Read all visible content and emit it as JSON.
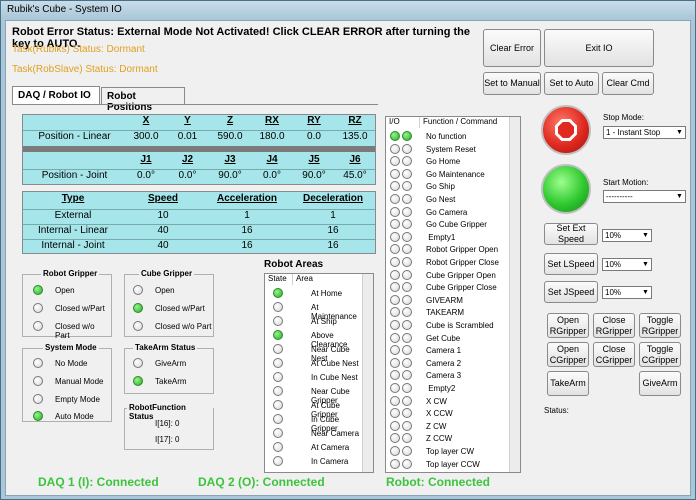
{
  "window": {
    "title": "Rubik's Cube - System IO"
  },
  "error_status": "Robot Error Status:  External Mode Not Activated!  Click CLEAR ERROR after turning the key to AUTO.",
  "task_rubiks": "Task(Rubiks) Status:  Dormant",
  "task_robslave": "Task(RobSlave) Status:  Dormant",
  "buttons": {
    "clear_error": "Clear Error",
    "exit_io": "Exit IO",
    "set_to_manual": "Set to Manual",
    "set_to_auto": "Set to Auto",
    "clear_cmd": "Clear Cmd",
    "set_ext_speed": "Set Ext Speed",
    "set_lspeed": "Set LSpeed",
    "set_jspeed": "Set JSpeed",
    "open_rgripper": "Open RGripper",
    "close_rgripper": "Close RGripper",
    "toggle_rgripper": "Toggle RGripper",
    "open_cgripper": "Open CGripper",
    "close_cgripper": "Close CGripper",
    "toggle_cgripper": "Toggle CGripper",
    "takearm": "TakeArm",
    "givearm": "GiveArm"
  },
  "tabs": [
    "DAQ / Robot IO",
    "Robot Positions"
  ],
  "position_table": {
    "linear_headers": [
      "X",
      "Y",
      "Z",
      "RX",
      "RY",
      "RZ"
    ],
    "linear_label": "Position - Linear",
    "linear_values": [
      "300.0",
      "0.01",
      "590.0",
      "180.0",
      "0.0",
      "135.0"
    ],
    "joint_headers": [
      "J1",
      "J2",
      "J3",
      "J4",
      "J5",
      "J6"
    ],
    "joint_label": "Position - Joint",
    "joint_values": [
      "0.0°",
      "0.0°",
      "90.0°",
      "0.0°",
      "90.0°",
      "45.0°"
    ]
  },
  "speed_table": {
    "headers": [
      "Type",
      "Speed",
      "Acceleration",
      "Deceleration"
    ],
    "rows": [
      [
        "External",
        "10",
        "1",
        "1"
      ],
      [
        "Internal - Linear",
        "40",
        "16",
        "16"
      ],
      [
        "Internal - Joint",
        "40",
        "16",
        "16"
      ]
    ]
  },
  "robot_gripper": {
    "title": "Robot Gripper",
    "options": [
      "Open",
      "Closed w/Part",
      "Closed w/o Part"
    ]
  },
  "cube_gripper": {
    "title": "Cube Gripper",
    "options": [
      "Open",
      "Closed w/Part",
      "Closed w/o Part"
    ]
  },
  "system_mode": {
    "title": "System Mode",
    "options": [
      "No Mode",
      "Manual Mode",
      "Empty Mode",
      "Auto Mode"
    ]
  },
  "takearm_status": {
    "title": "TakeArm Status",
    "options": [
      "GiveArm",
      "TakeArm"
    ]
  },
  "robot_function_status": {
    "title": "RobotFunction Status",
    "lines": [
      "I[16]: 0",
      "I[17]: 0"
    ]
  },
  "robot_areas": {
    "title": "Robot Areas",
    "col_state": "State",
    "col_area": "Area",
    "items": [
      "At Home",
      "At Maintenance",
      "At Ship",
      "Above Clearance",
      "Near Cube Nest",
      "At Cube Nest",
      "In Cube Nest",
      "Near Cube Gripper",
      "At Cube Gripper",
      "In Cube Gripper",
      "Near Camera",
      "At Camera",
      "In Camera"
    ]
  },
  "io_list": {
    "col_io": "I/O",
    "col_func": "Function / Command",
    "items": [
      "No function",
      "System Reset",
      "Go Home",
      "Go Maintenance",
      "Go Ship",
      "Go Nest",
      "Go Camera",
      "Go Cube Gripper",
      " Empty1",
      "Robot Gripper Open",
      "Robot Gripper Close",
      "Cube Gripper Open",
      "Cube Gripper Close",
      "GIVEARM",
      "TAKEARM",
      "Cube is Scrambled",
      "Get Cube",
      "Camera 1",
      "Camera 2",
      "Camera 3",
      " Empty2",
      "X CW",
      "X CCW",
      "Z CW",
      "Z CCW",
      "Top layer CW",
      "Top layer CCW"
    ]
  },
  "stop_mode": {
    "label": "Stop Mode:",
    "value": "1 - Instant Stop"
  },
  "start_motion": {
    "label": "Start Motion:",
    "value": "----------"
  },
  "speeds": {
    "ext": "10%",
    "lspeed": "10%",
    "jspeed": "10%"
  },
  "status_label": "Status:",
  "connections": {
    "daq1": "DAQ 1 (I):  Connected",
    "daq2": "DAQ 2 (O):  Connected",
    "robot": "Robot:  Connected"
  },
  "colors": {
    "teal": "#a6e6ea",
    "green": "#2fc82f",
    "orange": "#e0a020",
    "stop_red": "#e02a20"
  }
}
